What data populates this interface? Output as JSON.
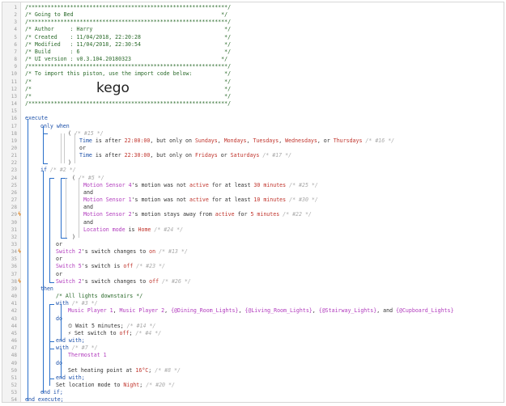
{
  "editor": {
    "logo_text": "kego",
    "lines": [
      {
        "n": "1",
        "x": 0,
        "cls": "",
        "segs": [
          {
            "t": "/**************************************************************/"
          }
        ]
      },
      {
        "n": "2",
        "x": 0,
        "cls": "",
        "segs": [
          {
            "t": "/* Going to Bed                                              */"
          }
        ]
      },
      {
        "n": "3",
        "x": 0,
        "cls": "",
        "segs": [
          {
            "t": "/**************************************************************/"
          }
        ]
      },
      {
        "n": "4",
        "x": 0,
        "cls": "",
        "segs": [
          {
            "t": "/* Author     : Harry                                         */"
          }
        ]
      },
      {
        "n": "5",
        "x": 0,
        "cls": "",
        "segs": [
          {
            "t": "/* Created    : 11/04/2018, 22:20:28                          */"
          }
        ]
      },
      {
        "n": "6",
        "x": 0,
        "cls": "",
        "segs": [
          {
            "t": "/* Modified   : 11/04/2018, 22:30:54                          */"
          }
        ]
      },
      {
        "n": "7",
        "x": 0,
        "cls": "",
        "segs": [
          {
            "t": "/* Build      : 6                                             */"
          }
        ]
      },
      {
        "n": "8",
        "x": 0,
        "cls": "",
        "segs": [
          {
            "t": "/* UI version : v0.3.104.20180323                            */"
          }
        ]
      },
      {
        "n": "9",
        "x": 0,
        "cls": "",
        "segs": [
          {
            "t": "/**************************************************************/"
          }
        ]
      },
      {
        "n": "10",
        "x": 0,
        "cls": "",
        "segs": [
          {
            "t": "/* To import this piston, use the import code below:          */"
          }
        ]
      },
      {
        "n": "11",
        "x": 0,
        "cls": "",
        "segs": [
          {
            "t": "/*                                                            */"
          }
        ]
      },
      {
        "n": "12",
        "x": 0,
        "cls": "",
        "segs": [
          {
            "t": "/*                                                            */"
          }
        ]
      },
      {
        "n": "13",
        "x": 0,
        "cls": "",
        "segs": [
          {
            "t": "/*                                                            */"
          }
        ]
      },
      {
        "n": "14",
        "x": 0,
        "cls": "",
        "segs": [
          {
            "t": "/**************************************************************/"
          }
        ]
      },
      {
        "n": "15",
        "x": 0,
        "cls": "",
        "segs": []
      },
      {
        "n": "16",
        "x": 0,
        "cls": "k",
        "segs": [
          {
            "t": "execute"
          }
        ]
      },
      {
        "n": "17",
        "x": 19,
        "cls": "k",
        "segs": [
          {
            "t": "only when"
          }
        ]
      },
      {
        "n": "18",
        "x": 53,
        "cls": "d",
        "segs": [
          {
            "t": "( "
          },
          {
            "t": "/* #15 */",
            "c": "c"
          }
        ]
      },
      {
        "n": "19",
        "x": 67,
        "cls": "d",
        "segs": [
          {
            "t": "Time",
            "c": "kw"
          },
          {
            "t": " is after "
          },
          {
            "t": "22:00:00",
            "c": "st"
          },
          {
            "t": ", but only on "
          },
          {
            "t": "Sundays",
            "c": "st"
          },
          {
            "t": ", "
          },
          {
            "t": "Mondays",
            "c": "st"
          },
          {
            "t": ", "
          },
          {
            "t": "Tuesdays",
            "c": "st"
          },
          {
            "t": ", "
          },
          {
            "t": "Wednesdays",
            "c": "st"
          },
          {
            "t": ", or "
          },
          {
            "t": "Thursdays",
            "c": "st"
          },
          {
            "t": " /* #16 */",
            "c": "c"
          }
        ]
      },
      {
        "n": "20",
        "x": 67,
        "cls": "d",
        "segs": [
          {
            "t": "or"
          }
        ]
      },
      {
        "n": "21",
        "x": 67,
        "cls": "d",
        "segs": [
          {
            "t": "Time",
            "c": "kw"
          },
          {
            "t": " is after "
          },
          {
            "t": "22:30:00",
            "c": "st"
          },
          {
            "t": ", but only on "
          },
          {
            "t": "Fridays",
            "c": "st"
          },
          {
            "t": " or "
          },
          {
            "t": "Saturdays",
            "c": "st"
          },
          {
            "t": " /* #17 */",
            "c": "c"
          }
        ]
      },
      {
        "n": "22",
        "x": 53,
        "cls": "d",
        "segs": [
          {
            "t": ")"
          }
        ]
      },
      {
        "n": "23",
        "x": 19,
        "cls": "k",
        "segs": [
          {
            "t": "if "
          },
          {
            "t": "/* #2 */",
            "c": "c"
          }
        ]
      },
      {
        "n": "24",
        "x": 58,
        "cls": "d",
        "segs": [
          {
            "t": "( "
          },
          {
            "t": "/* #5 */",
            "c": "c"
          }
        ]
      },
      {
        "n": "25",
        "x": 72,
        "cls": "d",
        "segs": [
          {
            "t": "Motion Sensor 4",
            "c": "dev"
          },
          {
            "t": "'s motion was not "
          },
          {
            "t": "active",
            "c": "st"
          },
          {
            "t": " for at least "
          },
          {
            "t": "30 minutes",
            "c": "st"
          },
          {
            "t": " /* #25 */",
            "c": "c"
          }
        ]
      },
      {
        "n": "26",
        "x": 72,
        "cls": "d",
        "segs": [
          {
            "t": "and"
          }
        ]
      },
      {
        "n": "27",
        "x": 72,
        "cls": "d",
        "segs": [
          {
            "t": "Motion Sensor 1",
            "c": "dev"
          },
          {
            "t": "'s motion was not "
          },
          {
            "t": "active",
            "c": "st"
          },
          {
            "t": " for at least "
          },
          {
            "t": "10 minutes",
            "c": "st"
          },
          {
            "t": " /* #30 */",
            "c": "c"
          }
        ]
      },
      {
        "n": "28",
        "x": 72,
        "cls": "d",
        "segs": [
          {
            "t": "and"
          }
        ]
      },
      {
        "n": "29",
        "x": 72,
        "cls": "d",
        "mk": "ϟ",
        "segs": [
          {
            "t": "Motion Sensor 2",
            "c": "dev"
          },
          {
            "t": "'s motion stays away from "
          },
          {
            "t": "active",
            "c": "st"
          },
          {
            "t": " for "
          },
          {
            "t": "5 minutes",
            "c": "st"
          },
          {
            "t": " /* #22 */",
            "c": "c"
          }
        ]
      },
      {
        "n": "30",
        "x": 72,
        "cls": "d",
        "segs": [
          {
            "t": "and"
          }
        ]
      },
      {
        "n": "31",
        "x": 72,
        "cls": "d",
        "segs": [
          {
            "t": "Location mode",
            "c": "dev"
          },
          {
            "t": " is "
          },
          {
            "t": "Home",
            "c": "st"
          },
          {
            "t": " /* #24 */",
            "c": "c"
          }
        ]
      },
      {
        "n": "32",
        "x": 58,
        "cls": "d",
        "segs": [
          {
            "t": ")"
          }
        ]
      },
      {
        "n": "33",
        "x": 38,
        "cls": "d",
        "segs": [
          {
            "t": "or"
          }
        ]
      },
      {
        "n": "34",
        "x": 38,
        "cls": "d",
        "mk": "ϟ",
        "segs": [
          {
            "t": "Switch 2",
            "c": "dev"
          },
          {
            "t": "'s switch changes to "
          },
          {
            "t": "on",
            "c": "st"
          },
          {
            "t": " /* #13 */",
            "c": "c"
          }
        ]
      },
      {
        "n": "35",
        "x": 38,
        "cls": "d",
        "segs": [
          {
            "t": "or"
          }
        ]
      },
      {
        "n": "36",
        "x": 38,
        "cls": "d",
        "segs": [
          {
            "t": "Switch 5",
            "c": "dev"
          },
          {
            "t": "'s switch is "
          },
          {
            "t": "off",
            "c": "st"
          },
          {
            "t": " /* #23 */",
            "c": "c"
          }
        ]
      },
      {
        "n": "37",
        "x": 38,
        "cls": "d",
        "segs": [
          {
            "t": "or"
          }
        ]
      },
      {
        "n": "38",
        "x": 38,
        "cls": "d",
        "mk": "ϟ",
        "segs": [
          {
            "t": "Switch 2",
            "c": "dev"
          },
          {
            "t": "'s switch changes to "
          },
          {
            "t": "off",
            "c": "st"
          },
          {
            "t": " /* #26 */",
            "c": "c"
          }
        ]
      },
      {
        "n": "39",
        "x": 19,
        "cls": "k",
        "segs": [
          {
            "t": "then"
          }
        ]
      },
      {
        "n": "40",
        "x": 38,
        "cls": "",
        "segs": [
          {
            "t": "/* All lights downstairs */"
          }
        ]
      },
      {
        "n": "41",
        "x": 38,
        "cls": "k",
        "segs": [
          {
            "t": "with "
          },
          {
            "t": "/* #3 */",
            "c": "c"
          }
        ]
      },
      {
        "n": "42",
        "x": 53,
        "cls": "d",
        "segs": [
          {
            "t": "Music Player 1",
            "c": "dev"
          },
          {
            "t": ", "
          },
          {
            "t": "Music Player 2",
            "c": "dev"
          },
          {
            "t": ", "
          },
          {
            "t": "{@Dining_Room_Lights}",
            "c": "dv"
          },
          {
            "t": ", "
          },
          {
            "t": "{@Living_Room_Lights}",
            "c": "dv"
          },
          {
            "t": ", "
          },
          {
            "t": "{@Stairway_Lights}",
            "c": "dv"
          },
          {
            "t": ", and "
          },
          {
            "t": "{@Cupboard_Lights}",
            "c": "dv"
          }
        ]
      },
      {
        "n": "43",
        "x": 38,
        "cls": "k",
        "segs": [
          {
            "t": "do"
          }
        ]
      },
      {
        "n": "44",
        "x": 53,
        "cls": "d",
        "segs": [
          {
            "t": "⏲ ",
            "c": "ic"
          },
          {
            "t": "Wait 5 minutes; "
          },
          {
            "t": "/* #14 */",
            "c": "c"
          }
        ]
      },
      {
        "n": "45",
        "x": 53,
        "cls": "d",
        "segs": [
          {
            "t": "⚡ ",
            "c": "ic"
          },
          {
            "t": "Set switch to "
          },
          {
            "t": "off",
            "c": "st"
          },
          {
            "t": "; "
          },
          {
            "t": "/* #4 */",
            "c": "c"
          }
        ]
      },
      {
        "n": "46",
        "x": 38,
        "cls": "k",
        "segs": [
          {
            "t": "end with;"
          }
        ]
      },
      {
        "n": "47",
        "x": 38,
        "cls": "k",
        "segs": [
          {
            "t": "with "
          },
          {
            "t": "/* #7 */",
            "c": "c"
          }
        ]
      },
      {
        "n": "48",
        "x": 53,
        "cls": "d",
        "segs": [
          {
            "t": "Thermostat 1",
            "c": "dev"
          }
        ]
      },
      {
        "n": "49",
        "x": 38,
        "cls": "k",
        "segs": [
          {
            "t": "do"
          }
        ]
      },
      {
        "n": "50",
        "x": 53,
        "cls": "d",
        "segs": [
          {
            "t": "Set heating point at "
          },
          {
            "t": "16°C",
            "c": "st"
          },
          {
            "t": "; "
          },
          {
            "t": "/* #8 */",
            "c": "c"
          }
        ]
      },
      {
        "n": "51",
        "x": 38,
        "cls": "k",
        "segs": [
          {
            "t": "end with;"
          }
        ]
      },
      {
        "n": "52",
        "x": 38,
        "cls": "d",
        "segs": [
          {
            "t": "Set location mode to "
          },
          {
            "t": "Night",
            "c": "st"
          },
          {
            "t": "; "
          },
          {
            "t": "/* #20 */",
            "c": "c"
          }
        ]
      },
      {
        "n": "53",
        "x": 19,
        "cls": "k",
        "segs": [
          {
            "t": "end if;"
          }
        ]
      },
      {
        "n": "54",
        "x": 0,
        "cls": "k",
        "segs": [
          {
            "t": "end execute;"
          }
        ]
      }
    ]
  }
}
